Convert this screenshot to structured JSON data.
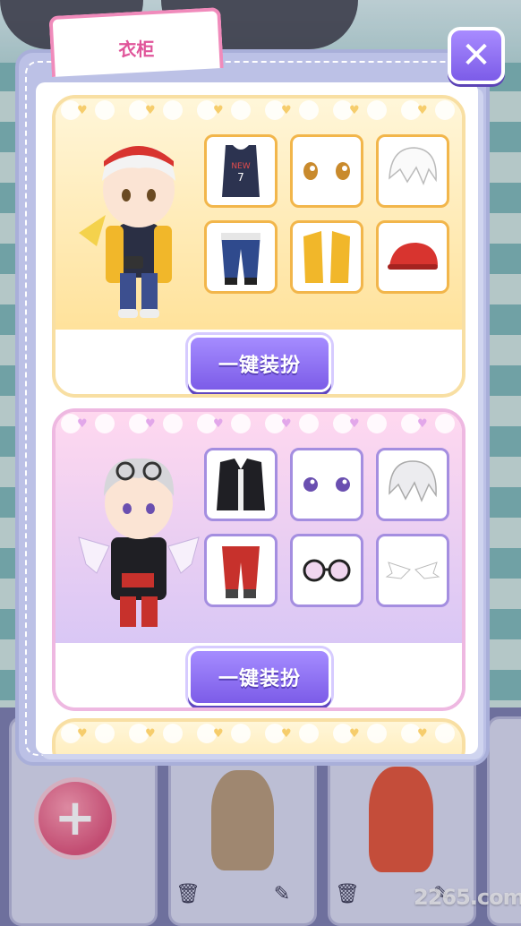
{
  "wardrobe": {
    "tab_label": "衣柜",
    "close_icon": "close-icon",
    "outfits": [
      {
        "theme": "gold",
        "items": [
          "jersey-icon",
          "eyes-icon",
          "white-hair-icon",
          "track-pants-icon",
          "yellow-jacket-icon",
          "red-cap-icon"
        ],
        "button_label": "一键装扮"
      },
      {
        "theme": "pink",
        "items": [
          "black-jacket-icon",
          "purple-eyes-icon",
          "silver-hair-icon",
          "red-pants-icon",
          "round-glasses-icon",
          "wings-icon"
        ],
        "button_label": "一键装扮"
      }
    ]
  },
  "background": {
    "add_label": "+",
    "watermark": "2265.com"
  },
  "colors": {
    "accent_purple": "#7c5ce8",
    "tab_pink": "#f08bbb",
    "gold_border": "#f2b64b",
    "lilac_border": "#a48ee0"
  }
}
